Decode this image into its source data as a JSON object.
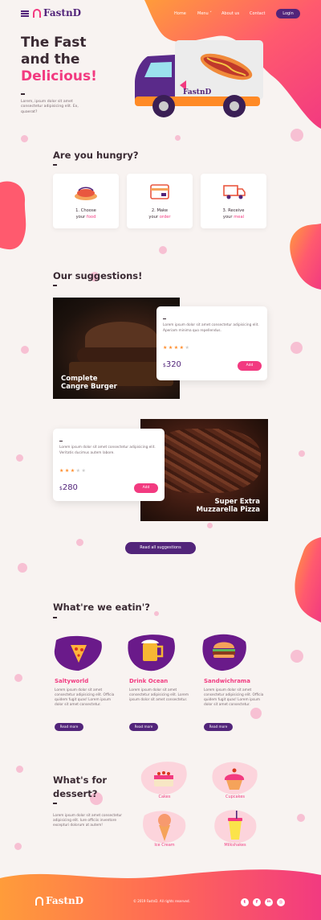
{
  "header": {
    "brand": "FastnD",
    "nav": [
      "Home",
      "Menu",
      "About us",
      "Contact"
    ],
    "login": "Login"
  },
  "hero": {
    "line1": "The Fast",
    "line2": "and the",
    "line3": "Delicious!",
    "text": "Lorem, ipsum dolor sit amet consectetur adipisicing elit. Ex, quaerat?",
    "truck_brand": "FastnD"
  },
  "hungry": {
    "title": "Are you hungry?",
    "steps": [
      {
        "pre": "1. Choose",
        "word1": "your",
        "accent": "food"
      },
      {
        "pre": "2. Make",
        "word1": "your",
        "accent": "order"
      },
      {
        "pre": "3. Receive",
        "word1": "your",
        "accent": "meal"
      }
    ]
  },
  "suggestions": {
    "title": "Our suggestions!",
    "items": [
      {
        "name_line1": "Complete",
        "name_line2": "Cangre Burger",
        "text": "Lorem ipsum dolor sit amet consectetur adipisicing elit. Aperiam minima quo repellendus.",
        "currency": "$",
        "price": "320",
        "add": "Add",
        "rating": 4
      },
      {
        "name_line1": "Super Extra",
        "name_line2": "Muzzarella Pizza",
        "text": "Lorem ipsum dolor sit amet consectetur adipisicing elit. Veritatis ducimus autem labore.",
        "currency": "$",
        "price": "280",
        "add": "Add",
        "rating": 3
      }
    ],
    "read_all": "Read all suggestions"
  },
  "eating": {
    "title": "What're we eatin'?",
    "items": [
      {
        "title": "Saltyworld",
        "text": "Lorem ipsum dolor sit amet consectetur adipisicing elit. Officia quidem fugit quas! Lorem ipsum dolor sit amet consectetur.",
        "button": "Read more"
      },
      {
        "title": "Drink Ocean",
        "text": "Lorem ipsum dolor sit amet consectetur adipisicing elit. Lorem ipsum dolor sit amet consectetur.",
        "button": "Read more"
      },
      {
        "title": "Sandwichrama",
        "text": "Lorem ipsum dolor sit amet consectetur adipisicing elit. Officia quidem fugit quas! Lorem ipsum dolor sit amet consectetur.",
        "button": "Read more"
      }
    ]
  },
  "dessert": {
    "title_line1": "What's for",
    "title_line2": "dessert?",
    "text": "Lorem ipsum dolor sit amet consectetur adipisicing elit. Iure officiis inventore excepturi dolorum at autem!",
    "items": [
      "Cakes",
      "Cupcakes",
      "Ice Cream",
      "Milkshakes"
    ]
  },
  "footer": {
    "brand": "FastnD",
    "copyright": "© 2019 FastnD. All rights reserved.",
    "social": [
      "t",
      "f",
      "in",
      "◎"
    ]
  },
  "colors": {
    "primary": "#f23a80",
    "purple": "#52247a",
    "orange": "#ff8c2a"
  }
}
